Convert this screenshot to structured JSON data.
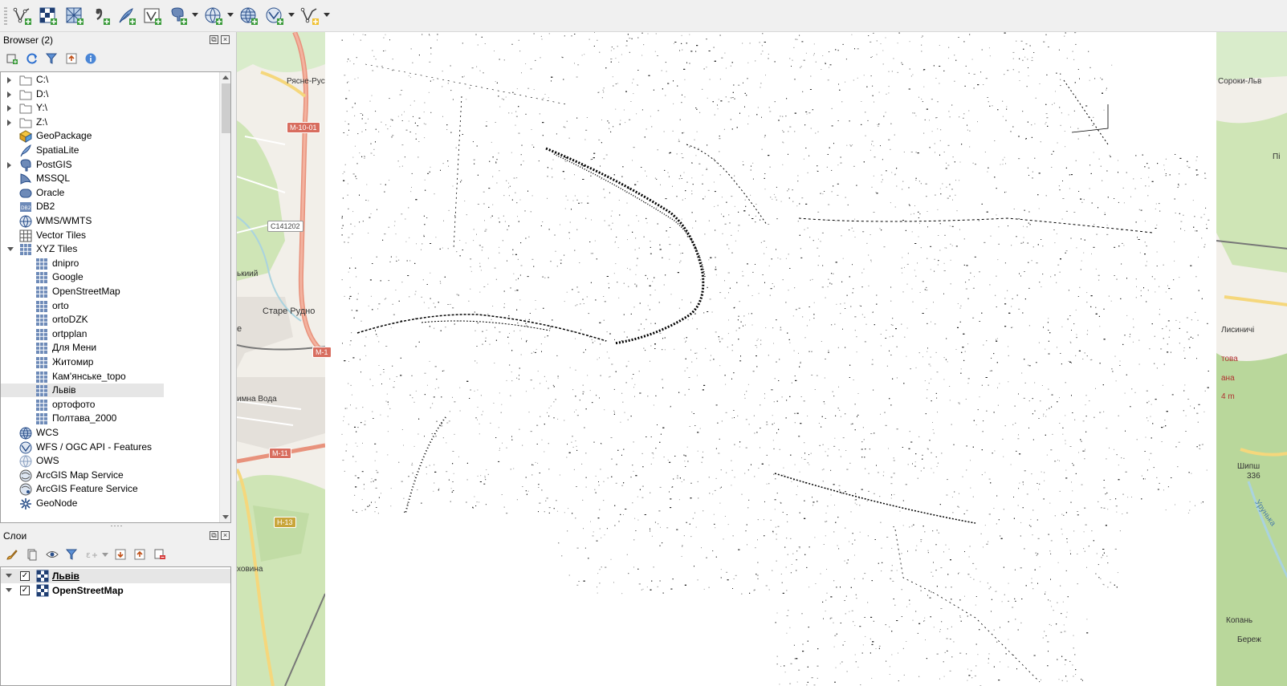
{
  "toolbar": {
    "buttons": [
      {
        "name": "new-vector-layer",
        "icon": "vector-point-add-icon"
      },
      {
        "name": "add-raster-layer",
        "icon": "raster-add-icon"
      },
      {
        "name": "add-mesh-layer",
        "icon": "mesh-add-icon"
      },
      {
        "name": "add-delimited-text-layer",
        "icon": "comma-add-icon"
      },
      {
        "name": "add-spatialite-layer",
        "icon": "feather-add-icon"
      },
      {
        "name": "add-virtual-layer",
        "icon": "virtual-layer-add-icon"
      },
      {
        "name": "add-postgis-layer",
        "icon": "postgis-elephant-add-icon"
      },
      {
        "name": "add-wms-layer",
        "icon": "globe-wms-add-icon"
      },
      {
        "name": "add-wcs-layer",
        "icon": "globe-wcs-add-icon"
      },
      {
        "name": "add-wfs-layer",
        "icon": "globe-wfs-add-icon"
      },
      {
        "name": "new-temporary-layer",
        "icon": "vector-temp-add-icon"
      }
    ]
  },
  "browser": {
    "title": "Browser (2)",
    "tools": [
      "add-selected-layers-icon",
      "refresh-icon",
      "filter-icon",
      "collapse-all-icon",
      "properties-info-icon"
    ],
    "items": [
      {
        "label": "C:\\",
        "icon": "folder-icon",
        "expander": "closed",
        "depth": 0
      },
      {
        "label": "D:\\",
        "icon": "folder-icon",
        "expander": "closed",
        "depth": 0
      },
      {
        "label": "Y:\\",
        "icon": "folder-icon",
        "expander": "closed",
        "depth": 0
      },
      {
        "label": "Z:\\",
        "icon": "folder-icon",
        "expander": "closed",
        "depth": 0
      },
      {
        "label": "GeoPackage",
        "icon": "geopackage-icon",
        "expander": "none",
        "depth": 0
      },
      {
        "label": "SpatiaLite",
        "icon": "spatialite-icon",
        "expander": "none",
        "depth": 0
      },
      {
        "label": "PostGIS",
        "icon": "postgis-icon",
        "expander": "closed",
        "depth": 0
      },
      {
        "label": "MSSQL",
        "icon": "mssql-icon",
        "expander": "none",
        "depth": 0
      },
      {
        "label": "Oracle",
        "icon": "oracle-icon",
        "expander": "none",
        "depth": 0
      },
      {
        "label": "DB2",
        "icon": "db2-icon",
        "expander": "none",
        "depth": 0
      },
      {
        "label": "WMS/WMTS",
        "icon": "wms-globe-icon",
        "expander": "none",
        "depth": 0
      },
      {
        "label": "Vector Tiles",
        "icon": "vector-tiles-icon",
        "expander": "none",
        "depth": 0
      },
      {
        "label": "XYZ Tiles",
        "icon": "xyz-tiles-icon",
        "expander": "open",
        "depth": 0
      },
      {
        "label": "dnipro",
        "icon": "xyz-tile-icon",
        "expander": "none",
        "depth": 1
      },
      {
        "label": "Google",
        "icon": "xyz-tile-icon",
        "expander": "none",
        "depth": 1
      },
      {
        "label": "OpenStreetMap",
        "icon": "xyz-tile-icon",
        "expander": "none",
        "depth": 1
      },
      {
        "label": "orto",
        "icon": "xyz-tile-icon",
        "expander": "none",
        "depth": 1
      },
      {
        "label": "ortoDZK",
        "icon": "xyz-tile-icon",
        "expander": "none",
        "depth": 1
      },
      {
        "label": "ortpplan",
        "icon": "xyz-tile-icon",
        "expander": "none",
        "depth": 1
      },
      {
        "label": "Для Мени",
        "icon": "xyz-tile-icon",
        "expander": "none",
        "depth": 1
      },
      {
        "label": "Житомир",
        "icon": "xyz-tile-icon",
        "expander": "none",
        "depth": 1
      },
      {
        "label": "Кам'янське_topo",
        "icon": "xyz-tile-icon",
        "expander": "none",
        "depth": 1
      },
      {
        "label": "Львів",
        "icon": "xyz-tile-icon",
        "expander": "none",
        "depth": 1,
        "selected": true
      },
      {
        "label": "ортофото",
        "icon": "xyz-tile-icon",
        "expander": "none",
        "depth": 1
      },
      {
        "label": "Полтава_2000",
        "icon": "xyz-tile-icon",
        "expander": "none",
        "depth": 1
      },
      {
        "label": "WCS",
        "icon": "wcs-globe-icon",
        "expander": "none",
        "depth": 0
      },
      {
        "label": "WFS / OGC API - Features",
        "icon": "wfs-globe-icon",
        "expander": "none",
        "depth": 0
      },
      {
        "label": "OWS",
        "icon": "ows-globe-icon",
        "expander": "none",
        "depth": 0
      },
      {
        "label": "ArcGIS Map Service",
        "icon": "arcgis-map-icon",
        "expander": "none",
        "depth": 0
      },
      {
        "label": "ArcGIS Feature Service",
        "icon": "arcgis-feature-icon",
        "expander": "none",
        "depth": 0
      },
      {
        "label": "GeoNode",
        "icon": "geonode-icon",
        "expander": "none",
        "depth": 0
      }
    ]
  },
  "layers": {
    "title": "Слои",
    "tools": [
      "style-brush-icon",
      "add-group-icon",
      "visibility-eye-icon",
      "filter-legend-icon",
      "filter-expression-icon",
      "expand-all-icon",
      "collapse-all-icon",
      "remove-layer-icon"
    ],
    "items": [
      {
        "label": "Львів",
        "checked": true,
        "selected": true
      },
      {
        "label": "OpenStreetMap",
        "checked": true,
        "selected": false
      }
    ]
  },
  "map": {
    "labels": {
      "place_1": "Рясне-Рус",
      "place_2": "Старе Рудно",
      "place_3": "имна Вода",
      "place_4": "ькиий",
      "place_5": "е",
      "place_6": "ховина",
      "place_7": "Сороки-Льв",
      "place_8": "Лисиничі",
      "place_9": "Шипш",
      "place_10": "336",
      "place_11": "Копань",
      "place_12": "Береж",
      "place_13": "Урунька",
      "place_14": "това",
      "place_15": "ана",
      "place_16": "4 m",
      "place_17": "Пі"
    },
    "roads": {
      "m1001": "M-10-01",
      "c141202": "C141202",
      "m11": "M-11",
      "h13": "H-13",
      "m1": "M-1"
    },
    "colors": {
      "osm_green": "#cfe5b6",
      "osm_urban": "#e4e0da",
      "osm_road": "#e8927c",
      "osm_yellow": "#f5d77c",
      "osm_water": "#aad3df"
    }
  }
}
